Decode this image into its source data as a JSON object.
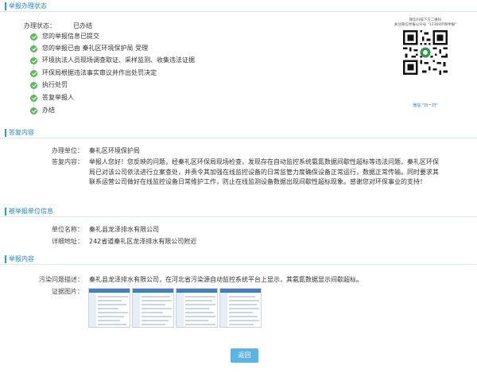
{
  "sections": {
    "status": "举报办理状态",
    "reply": "答复内容",
    "reported": "被举报单位信息",
    "report": "举报内容"
  },
  "status": {
    "label": "办理状态：",
    "value": "已办结",
    "steps": [
      "您的举报信息已提交",
      "您的举报已由 秦礼区环境保护局 受理",
      "环境执法人员现场调查取证、采样监测、收集违法证据",
      "环保局根据违法事实审议并作出处罚决定",
      "执行处罚",
      "答复举报人",
      "办结"
    ]
  },
  "qr": {
    "caption_line1": "微信扫描下方二维码",
    "caption_line2": "关注微信举报公众号 \"12369环保举报\"",
    "caption_line3": "微信 \"扫一扫\""
  },
  "reply": {
    "unit_label": "办理单位：",
    "unit_value": "秦礼区环境保护局",
    "content_label": "答复内容：",
    "content_value": "举报人您好！您反映的问题，经秦礼区环保局现场检查，发现存在自动监控系统氨氮数据间歇性超标等违法问题，秦礼区环保局已对该公司依法进行立案查处，并责令其加强在线监控设备的日常监管力度确保设备正常运行，数据正常传输。同时要求其联系运营公司做好在线监控设备日常维护工作，防止在线监测设备数据出现间歇性超标现象。感谢您对环保事业的支持！"
  },
  "reported": {
    "name_label": "单位名称：",
    "name_value": "秦礼县龙泽排水有限公司",
    "addr_label": "详细地址：",
    "addr_value": "242省道秦礼区龙泽排水有限公司附近"
  },
  "report": {
    "desc_label": "污染问题描述：",
    "desc_value": "秦礼县龙泽排水有限公司，在河北省污染源自动监控系统平台上显示，其氨氮数据显示间歇超标。",
    "images_label": "证据图片："
  },
  "buttons": {
    "back": "返回"
  },
  "colors": {
    "accent": "#2d9bd9",
    "check": "#5cb85c",
    "button": "#5ab4e5"
  }
}
